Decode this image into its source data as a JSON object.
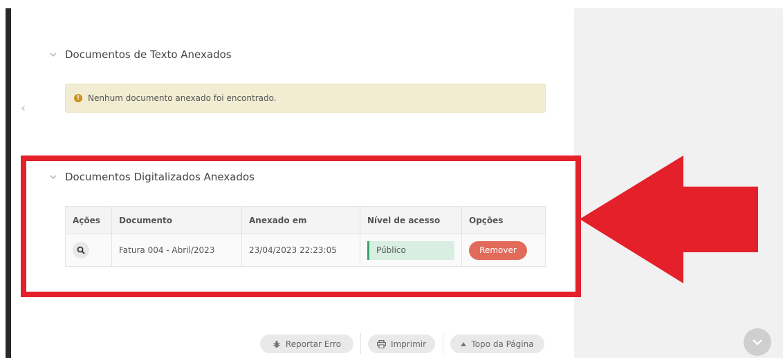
{
  "sections": {
    "text_docs": {
      "title": "Documentos de Texto Anexados",
      "alert": "Nenhum documento anexado foi encontrado."
    },
    "scanned_docs": {
      "title": "Documentos Digitalizados Anexados",
      "columns": [
        "Ações",
        "Documento",
        "Anexado em",
        "Nível de acesso",
        "Opções"
      ],
      "rows": [
        {
          "documento": "Fatura 004 - Abril/2023",
          "anexado_em": "23/04/2023 22:23:05",
          "nivel_acesso": "Público",
          "opcao": "Remover"
        }
      ]
    }
  },
  "footer": {
    "report": "Reportar Erro",
    "print": "Imprimir",
    "top": "Topo da Página"
  },
  "colors": {
    "highlight": "#e4202a",
    "alert_bg": "#f2ecd3",
    "remove_btn": "#e16a5a",
    "access_badge": "#d8eee2"
  },
  "icons": [
    "chevron-down-icon",
    "warning-icon",
    "search-icon",
    "bug-icon",
    "printer-icon",
    "caret-up-icon",
    "chevron-left-icon",
    "arrow-left-icon"
  ]
}
